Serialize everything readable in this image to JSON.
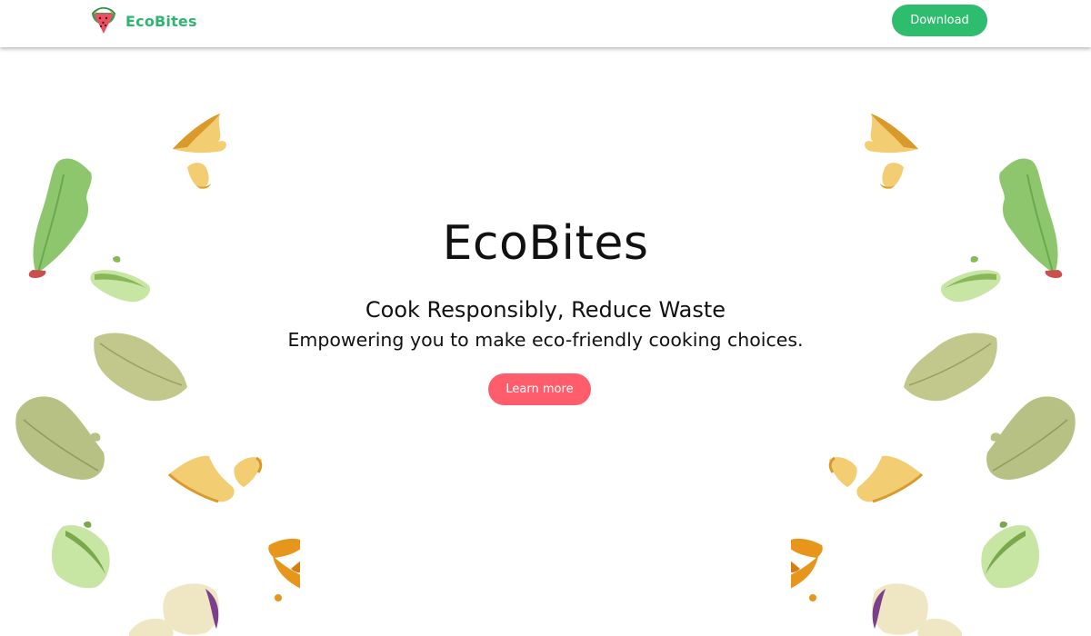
{
  "navbar": {
    "brand_name": "EcoBites",
    "download_label": "Download"
  },
  "hero": {
    "title": "EcoBites",
    "subtitle": "Cook Responsibly, Reduce Waste",
    "tagline": "Empowering you to make eco-friendly cooking choices.",
    "learn_more_label": "Learn more"
  },
  "colors": {
    "brand_green": "#2fb56f",
    "download_button": "#2ebd6f",
    "learn_more_button": "#ff5d6c",
    "text": "#111111"
  },
  "icons": {
    "logo": "watermelon-slice-icon",
    "decorations": [
      "lettuce-leaf",
      "bread-crust",
      "cucumber-slice",
      "cabbage-leaf",
      "carrot-peel",
      "potato-slice"
    ]
  }
}
